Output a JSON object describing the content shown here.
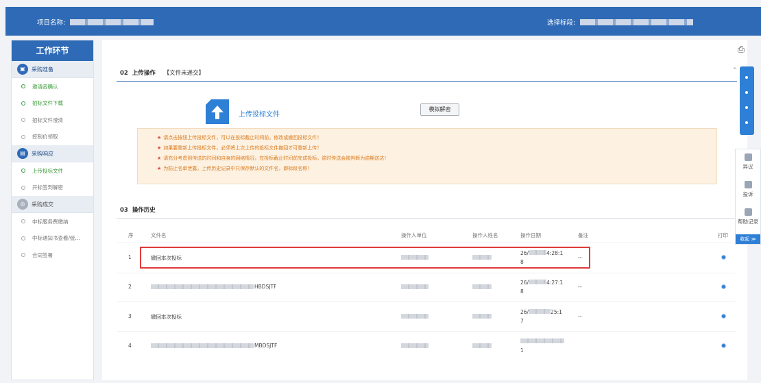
{
  "header": {
    "project_label": "项目名称:",
    "section_label": "选择标段:"
  },
  "sidebar": {
    "title": "工作环节",
    "groups": [
      {
        "label": "采购准备",
        "items": [
          "邀请函确认",
          "招标文件下载",
          "招标文件澄清",
          "控制价领取"
        ]
      },
      {
        "label": "采购响应",
        "items": [
          "上传投标文件",
          "开标签到解密"
        ]
      },
      {
        "label": "采购成交",
        "items": [
          "中标服务费缴纳",
          "中标通知书查看/统...",
          "合同签署"
        ]
      }
    ]
  },
  "upload_section": {
    "number": "02",
    "title": "上传操作",
    "status": "【文件未递交】",
    "upload_label": "上传投标文件",
    "decrypt_button": "模拟解密",
    "notices": [
      "请点击按钮上传投标文件，可以在投标截止时间前，修改或撤回投标文件！",
      "如果要重新上传投标文件，必须将上次上传的投标文件撤回才可重新上传！",
      "请充分考虑到传送的时间和自身的网络情况，在投标截止时间前完成投标，逾时传送会被判断为逾期送达！",
      "为防止名单泄露，上传历史记录中只保存默认的文件名，即标段名称！"
    ]
  },
  "history_section": {
    "number": "03",
    "title": "操作历史",
    "columns": [
      "序",
      "文件名",
      "操作人单位",
      "操作人姓名",
      "操作日期",
      "备注",
      "打印"
    ],
    "rows": [
      {
        "index": "1",
        "filename": "撤回本次投标",
        "date_a": "26/",
        "date_b": "4:28:1",
        "date_c": "8",
        "remark": "--"
      },
      {
        "index": "2",
        "filename": "HBDSJTF",
        "date_a": "26/",
        "date_b": "4:27:1",
        "date_c": "8",
        "remark": "--"
      },
      {
        "index": "3",
        "filename": "撤回本次投标",
        "date_a": "26/",
        "date_b": "25:1",
        "date_c": "7",
        "remark": "--"
      },
      {
        "index": "4",
        "filename": "MBDSJTF",
        "date_a": "",
        "date_b": "",
        "date_c": "1",
        "remark": ""
      }
    ]
  },
  "float_panel": {
    "items": [
      "异议",
      "投诉",
      "帮助记录"
    ],
    "collapse": "收起 ≫"
  },
  "icons": {
    "print": "printer-icon",
    "upload": "upload-arrow-icon"
  },
  "colors": {
    "brand_blue": "#2e6ab6",
    "accent_blue": "#2e7fd6",
    "notice_text": "#d97a1c",
    "highlight_red": "#e03a3a",
    "done_green": "#3c9a3a"
  }
}
